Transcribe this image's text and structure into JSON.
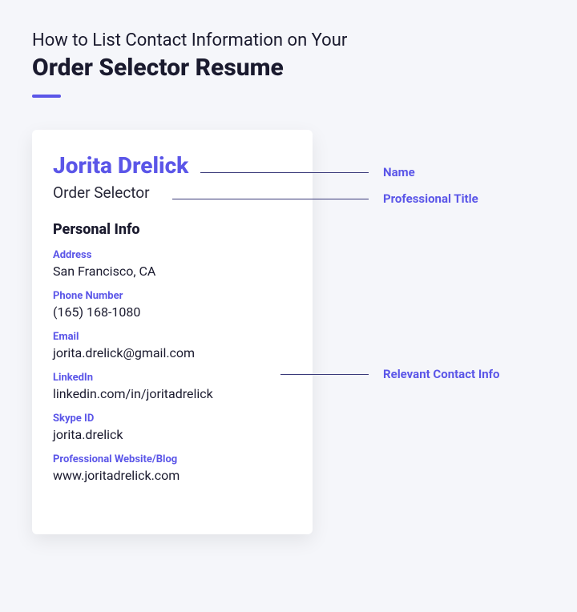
{
  "heading": {
    "line1": "How to List Contact Information on Your",
    "line2": "Order Selector Resume"
  },
  "resume": {
    "name": "Jorita Drelick",
    "title": "Order Selector",
    "section_title": "Personal Info",
    "fields": {
      "address": {
        "label": "Address",
        "value": "San Francisco, CA"
      },
      "phone": {
        "label": "Phone Number",
        "value": "(165) 168-1080"
      },
      "email": {
        "label": "Email",
        "value": "jorita.drelick@gmail.com"
      },
      "linkedin": {
        "label": "LinkedIn",
        "value": "linkedin.com/in/joritadrelick"
      },
      "skype": {
        "label": "Skype ID",
        "value": "jorita.drelick"
      },
      "website": {
        "label": "Professional Website/Blog",
        "value": "www.joritadrelick.com"
      }
    }
  },
  "annotations": {
    "name": "Name",
    "title": "Professional Title",
    "contact": "Relevant Contact Info"
  }
}
